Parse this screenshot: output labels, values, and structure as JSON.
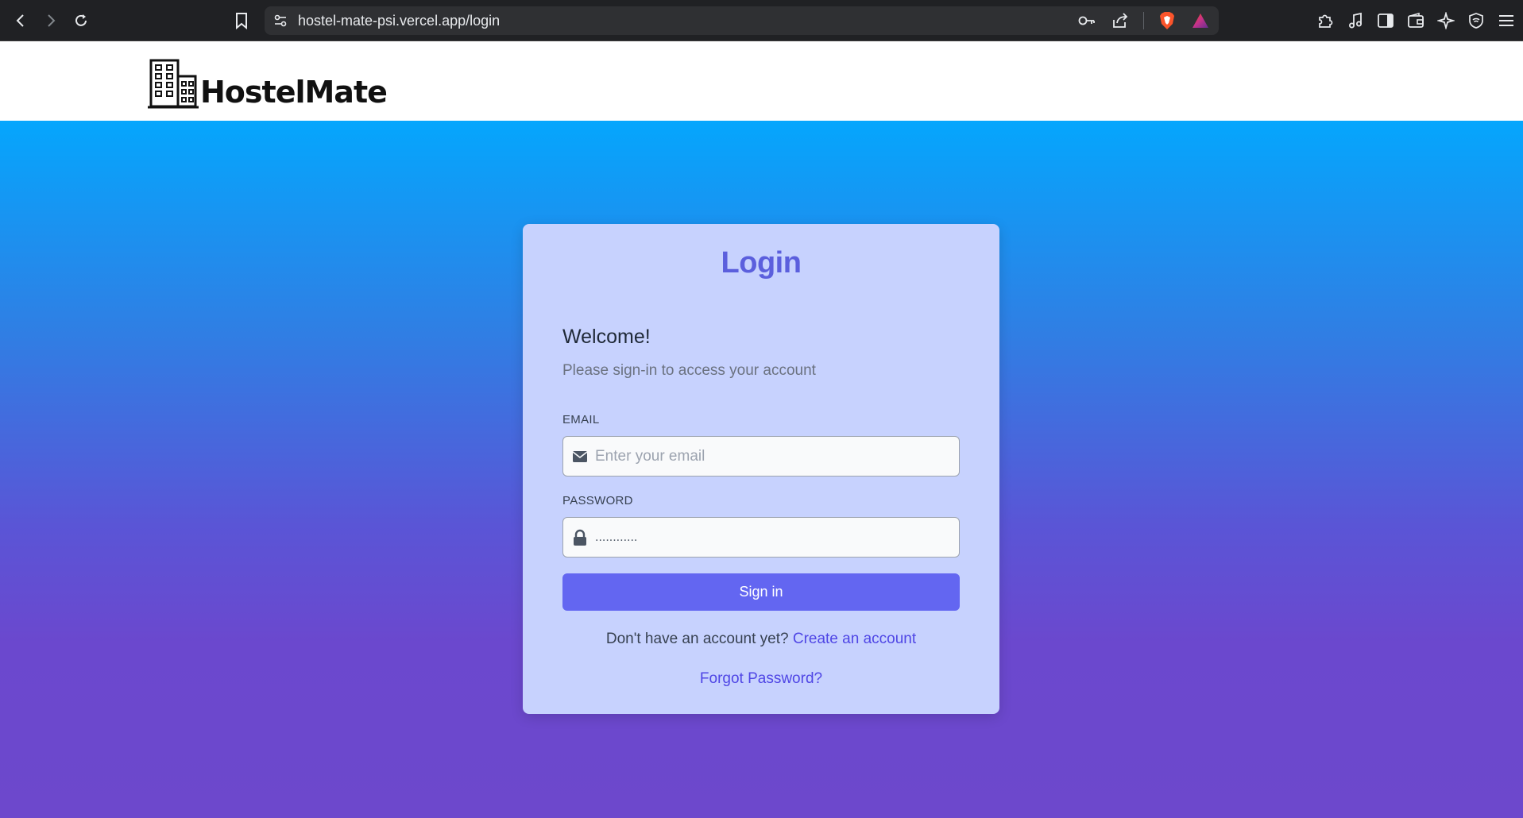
{
  "browser": {
    "url": "hostel-mate-psi.vercel.app/login",
    "icons": [
      "back-icon",
      "forward-icon",
      "reload-icon",
      "bookmark-icon",
      "site-settings-icon",
      "key-icon",
      "share-icon",
      "brave-shield-icon",
      "brave-rewards-icon",
      "extensions-icon",
      "media-icon",
      "sidebar-icon",
      "wallet-icon",
      "leo-ai-icon",
      "vpn-icon",
      "menu-icon"
    ]
  },
  "site": {
    "brand": "HostelMate"
  },
  "login": {
    "title": "Login",
    "welcome": "Welcome!",
    "subtitle": "Please sign-in to access your account",
    "email_label": "EMAIL",
    "email_placeholder": "Enter your email",
    "email_value": "",
    "password_label": "PASSWORD",
    "password_value": "............",
    "signin_label": "Sign in",
    "no_account_text": "Don't have an account yet?",
    "create_account_link": "Create an account",
    "forgot_password_link": "Forgot Password?"
  },
  "colors": {
    "accent": "#6366f1",
    "title": "#5b5fdd",
    "card_bg": "#c7d2fe",
    "gradient_top": "#05a6fd",
    "gradient_bottom": "#6d48cc"
  }
}
